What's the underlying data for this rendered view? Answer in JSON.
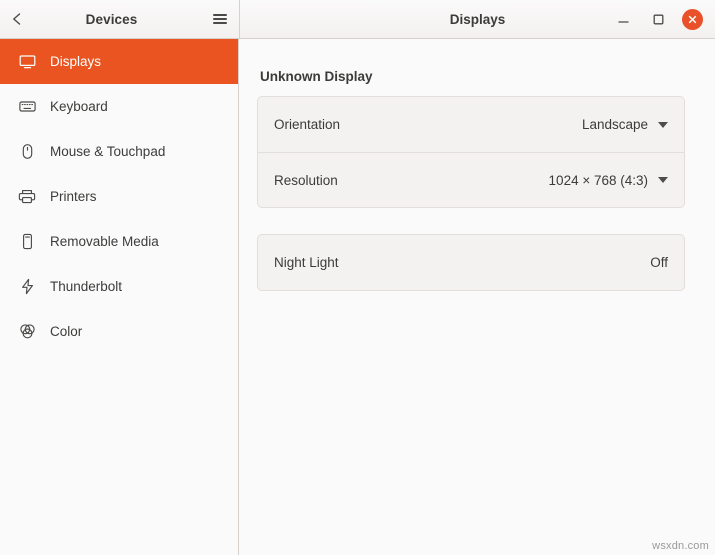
{
  "window": {
    "left_title": "Devices",
    "right_title": "Displays",
    "back_icon": "back-chevron-icon",
    "menu_icon": "hamburger-menu-icon",
    "minimize_icon": "minimize-icon",
    "maximize_icon": "maximize-icon",
    "close_icon": "close-icon",
    "close_color": "#e9512b"
  },
  "sidebar": {
    "accent_color": "#e95420",
    "items": [
      {
        "label": "Displays",
        "icon": "display-icon",
        "active": true
      },
      {
        "label": "Keyboard",
        "icon": "keyboard-icon",
        "active": false
      },
      {
        "label": "Mouse & Touchpad",
        "icon": "mouse-icon",
        "active": false
      },
      {
        "label": "Printers",
        "icon": "printer-icon",
        "active": false
      },
      {
        "label": "Removable Media",
        "icon": "removable-media-icon",
        "active": false
      },
      {
        "label": "Thunderbolt",
        "icon": "thunderbolt-icon",
        "active": false
      },
      {
        "label": "Color",
        "icon": "color-icon",
        "active": false
      }
    ]
  },
  "main": {
    "section_title": "Unknown Display",
    "display_rows": [
      {
        "label": "Orientation",
        "value": "Landscape",
        "has_caret": true
      },
      {
        "label": "Resolution",
        "value": "1024 × 768 (4:3)",
        "has_caret": true
      }
    ],
    "night_light": {
      "label": "Night Light",
      "value": "Off",
      "has_caret": false
    }
  },
  "watermark": "wsxdn.com"
}
